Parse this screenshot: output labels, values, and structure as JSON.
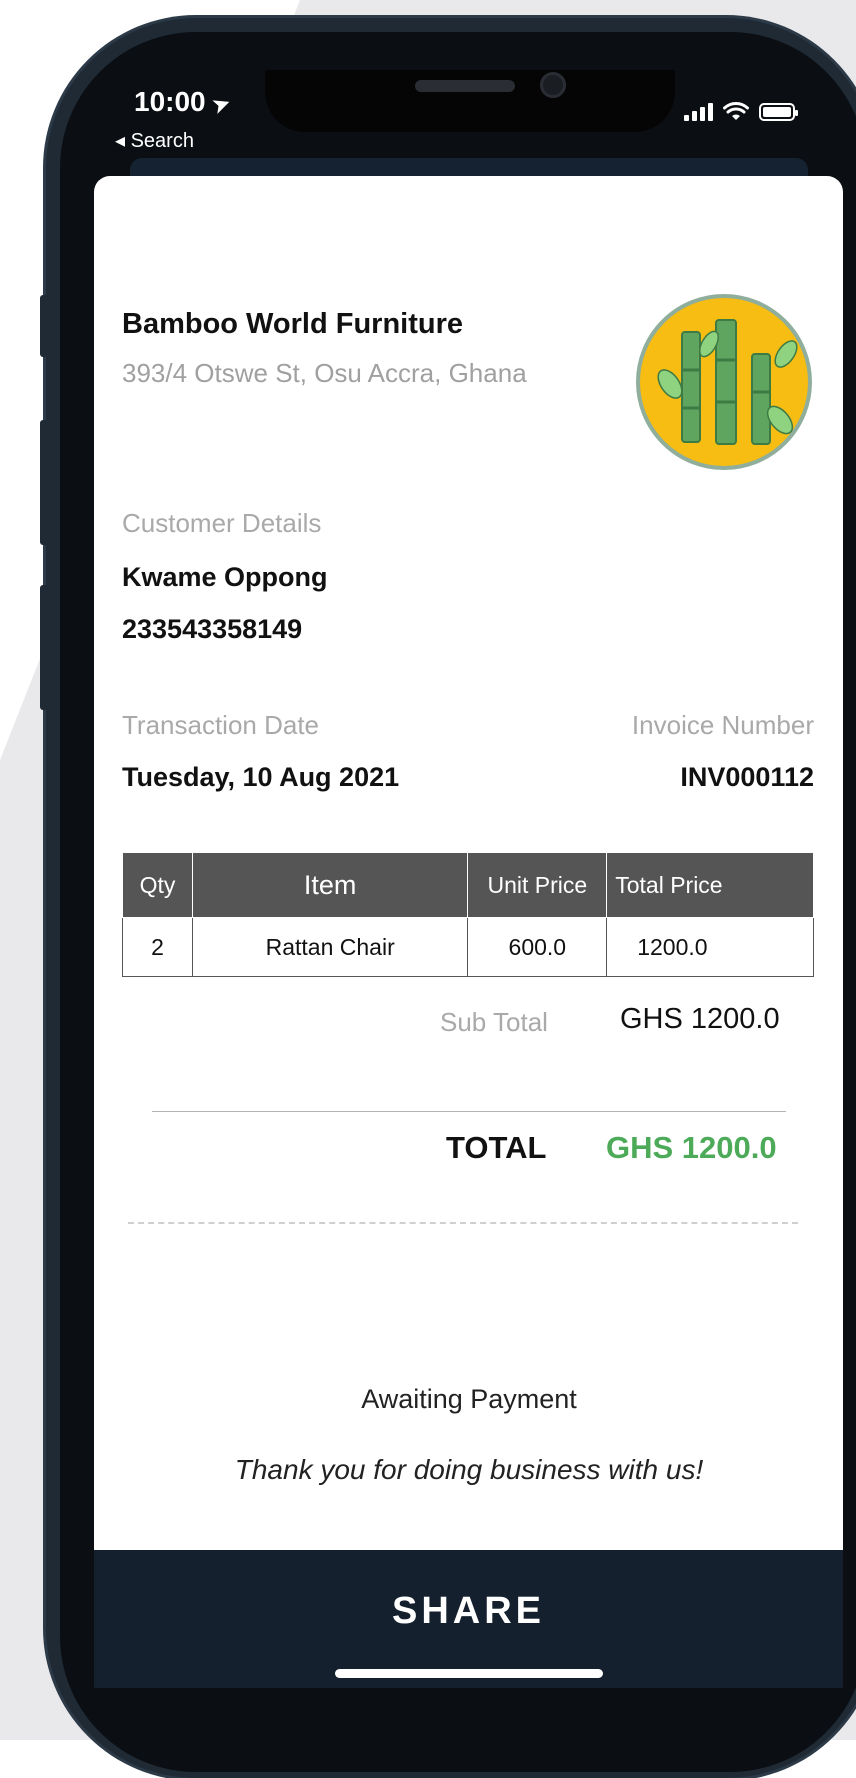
{
  "status_bar": {
    "time": "10:00",
    "location_icon": "location-arrow-icon",
    "back_label": "◂ Search",
    "icons": [
      "signal-icon",
      "wifi-icon",
      "battery-icon"
    ]
  },
  "business": {
    "name": "Bamboo World Furniture",
    "address": "393/4 Otswe St, Osu Accra, Ghana",
    "logo_icon": "bamboo-logo-icon",
    "logo_colors": {
      "background": "#f7bd12",
      "bamboo": "#5fa560",
      "ring": "#7aa08a"
    }
  },
  "customer": {
    "label": "Customer Details",
    "name": "Kwame Oppong",
    "phone": "233543358149"
  },
  "transaction": {
    "date_label": "Transaction Date",
    "date_value": "Tuesday, 10 Aug 2021",
    "invoice_label": "Invoice Number",
    "invoice_value": "INV000112"
  },
  "table": {
    "headers": [
      "Qty",
      "Item",
      "Unit Price",
      "Total Price"
    ],
    "rows": [
      [
        "2",
        "Rattan Chair",
        "600.0",
        "1200.0"
      ]
    ]
  },
  "totals": {
    "sub_label": "Sub Total",
    "sub_value": "GHS 1200.0",
    "total_label": "TOTAL",
    "total_value": "GHS 1200.0",
    "total_color": "#4caa59"
  },
  "footer": {
    "status": "Awaiting Payment",
    "thanks": "Thank you for doing business with us!"
  },
  "share": {
    "label": "SHARE",
    "bar_color": "#14202d"
  }
}
